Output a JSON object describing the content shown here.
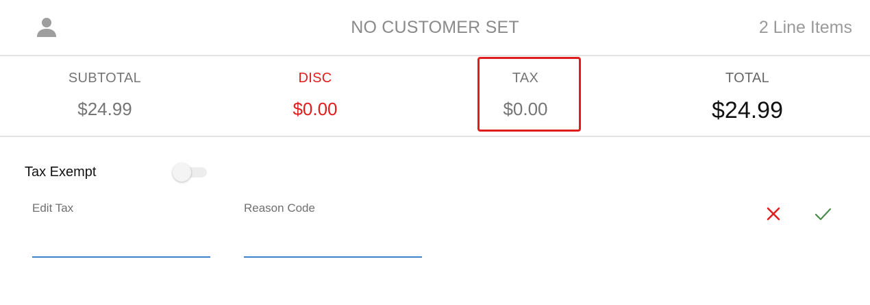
{
  "header": {
    "customer_label": "NO CUSTOMER SET",
    "line_items": "2 Line Items",
    "avatar_icon": "person-icon"
  },
  "totals": {
    "subtotal": {
      "label": "SUBTOTAL",
      "value": "$24.99"
    },
    "discount": {
      "label": "DISC",
      "value": "$0.00"
    },
    "tax": {
      "label": "TAX",
      "value": "$0.00"
    },
    "total": {
      "label": "TOTAL",
      "value": "$24.99"
    }
  },
  "tax_edit": {
    "tax_exempt_label": "Tax Exempt",
    "tax_exempt_on": false,
    "edit_tax_label": "Edit Tax",
    "edit_tax_value": "",
    "reason_code_label": "Reason Code",
    "reason_code_value": "",
    "cancel_icon": "close-icon",
    "confirm_icon": "check-icon"
  },
  "colors": {
    "discount": "#e21d1d",
    "highlight": "#e01b1b",
    "input_underline": "#3d7fc9",
    "confirm": "#4a8a4a",
    "muted_text": "#757575"
  }
}
